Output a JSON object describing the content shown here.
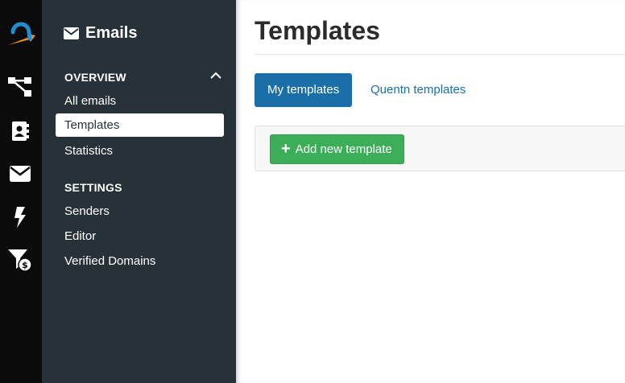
{
  "rail": {
    "icons": [
      "quentn-logo",
      "workflow-icon",
      "contacts-icon",
      "email-icon",
      "lightning-icon",
      "funnel-dollar-icon"
    ]
  },
  "sidebar": {
    "title": "Emails",
    "sections": [
      {
        "label": "OVERVIEW",
        "items": [
          {
            "label": "All emails"
          },
          {
            "label": "Templates",
            "active": true
          },
          {
            "label": "Statistics"
          }
        ]
      },
      {
        "label": "SETTINGS",
        "items": [
          {
            "label": "Senders"
          },
          {
            "label": "Editor"
          },
          {
            "label": "Verified Domains"
          }
        ]
      }
    ]
  },
  "main": {
    "title": "Templates",
    "tabs": [
      {
        "label": "My templates",
        "active": true
      },
      {
        "label": "Quentn templates"
      }
    ],
    "add_button": {
      "plus": "+",
      "label": "Add new template"
    }
  },
  "colors": {
    "rail_bg": "#0b0b0b",
    "sidebar_bg": "#263238",
    "accent_blue": "#1a6fa8",
    "add_green": "#3cae58",
    "logo_blue": "#1f8fd1",
    "logo_orange": "#f08a24"
  }
}
